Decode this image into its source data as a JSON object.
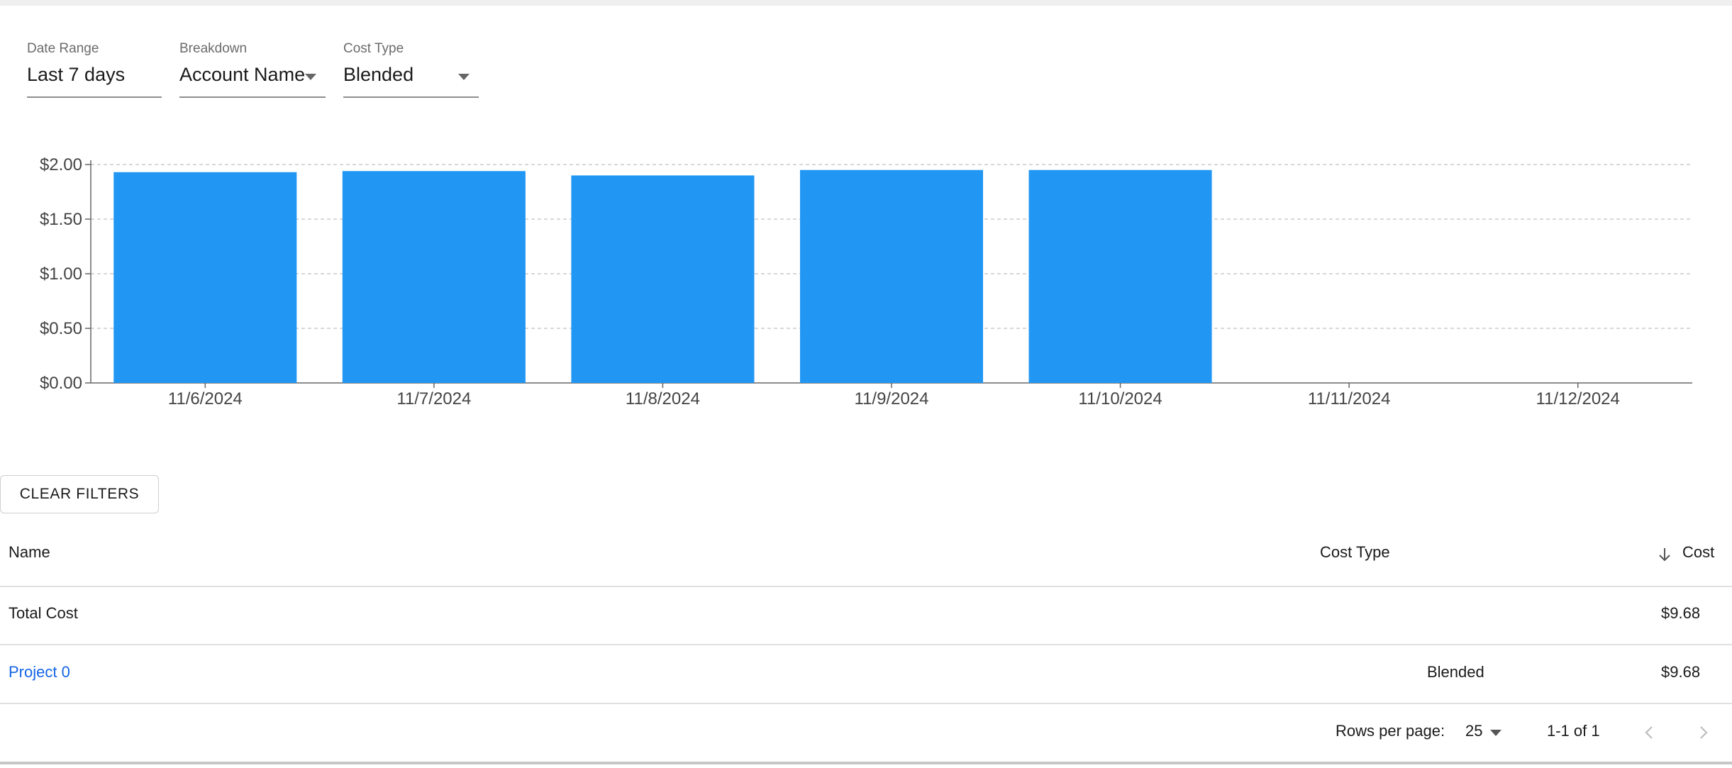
{
  "filters": {
    "date_range": {
      "label": "Date Range",
      "value": "Last 7 days"
    },
    "breakdown": {
      "label": "Breakdown",
      "value": "Account Name"
    },
    "cost_type": {
      "label": "Cost Type",
      "value": "Blended"
    }
  },
  "chart_data": {
    "type": "bar",
    "categories": [
      "11/6/2024",
      "11/7/2024",
      "11/8/2024",
      "11/9/2024",
      "11/10/2024",
      "11/11/2024",
      "11/12/2024"
    ],
    "values": [
      1.93,
      1.94,
      1.9,
      1.95,
      1.95,
      null,
      null
    ],
    "yticks": [
      "$0.00",
      "$0.50",
      "$1.00",
      "$1.50",
      "$2.00"
    ],
    "ylim": [
      0,
      2
    ],
    "grid": "horizontal dashed",
    "bar_color": "#2196f3"
  },
  "clear_filters_label": "CLEAR FILTERS",
  "table": {
    "headers": {
      "name": "Name",
      "cost_type": "Cost Type",
      "cost": "Cost"
    },
    "total_row": {
      "name": "Total Cost",
      "cost": "$9.68"
    },
    "rows": [
      {
        "name": "Project 0",
        "cost_type": "Blended",
        "cost": "$9.68"
      }
    ]
  },
  "pagination": {
    "rows_per_page_label": "Rows per page:",
    "rows_per_page": "25",
    "range": "1-1 of 1"
  },
  "colors": {
    "accent": "#2196f3",
    "link": "#1565e6"
  }
}
